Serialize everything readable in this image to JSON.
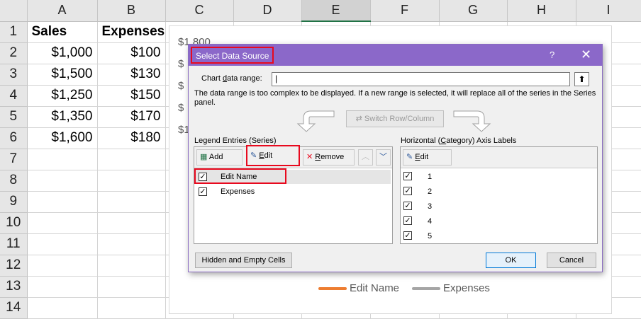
{
  "sheet": {
    "columns": [
      "A",
      "B",
      "C",
      "D",
      "E",
      "F",
      "G",
      "H",
      "I"
    ],
    "rows": [
      {
        "num": "1",
        "a": "Sales",
        "b": "Expenses"
      },
      {
        "num": "2",
        "a": "$1,000",
        "b": "$100"
      },
      {
        "num": "3",
        "a": "$1,500",
        "b": "$130"
      },
      {
        "num": "4",
        "a": "$1,250",
        "b": "$150"
      },
      {
        "num": "5",
        "a": "$1,350",
        "b": "$170"
      },
      {
        "num": "6",
        "a": "$1,600",
        "b": "$180"
      },
      {
        "num": "7",
        "a": "",
        "b": ""
      },
      {
        "num": "8",
        "a": "",
        "b": ""
      },
      {
        "num": "9",
        "a": "",
        "b": ""
      },
      {
        "num": "10",
        "a": "",
        "b": ""
      },
      {
        "num": "11",
        "a": "",
        "b": ""
      },
      {
        "num": "12",
        "a": "",
        "b": ""
      },
      {
        "num": "13",
        "a": "",
        "b": ""
      },
      {
        "num": "14",
        "a": "",
        "b": ""
      }
    ]
  },
  "chart": {
    "y_ticks": [
      "$1,800",
      "$",
      "$",
      "$",
      "$1"
    ],
    "legend": [
      {
        "label": "Edit Name",
        "color": "#ed7d31"
      },
      {
        "label": "Expenses",
        "color": "#a5a5a5"
      }
    ]
  },
  "dialog": {
    "title": "Select Data Source",
    "help": "?",
    "close": "✕",
    "range_label_pre": "Chart ",
    "range_label_key": "d",
    "range_label_post": "ata range:",
    "range_value": "",
    "range_button": "⬆",
    "message": "The data range is too complex to be displayed. If a new range is selected, it will replace all of the series in the Series panel.",
    "switch_button": "Switch Row/Column",
    "legend_panel_title": "Legend Entries (Series)",
    "axis_panel_title_pre": "Horizontal (",
    "axis_panel_title_key": "C",
    "axis_panel_title_post": "ategory) Axis Labels",
    "legend_toolbar": {
      "add": "Add",
      "edit_key": "E",
      "edit_rest": "dit",
      "remove_key": "R",
      "remove_rest": "emove"
    },
    "axis_toolbar": {
      "edit_key": "E",
      "edit_rest": "dit"
    },
    "series": [
      {
        "label": "Edit Name",
        "checked": true
      },
      {
        "label": "Expenses",
        "checked": true
      }
    ],
    "categories": [
      {
        "label": "1",
        "checked": true
      },
      {
        "label": "2",
        "checked": true
      },
      {
        "label": "3",
        "checked": true
      },
      {
        "label": "4",
        "checked": true
      },
      {
        "label": "5",
        "checked": true
      }
    ],
    "hidden_cells_button": "Hidden and Empty Cells",
    "ok_button": "OK",
    "cancel_button": "Cancel",
    "accent_color": "#8b68c9",
    "highlight_color": "#e8091e"
  }
}
